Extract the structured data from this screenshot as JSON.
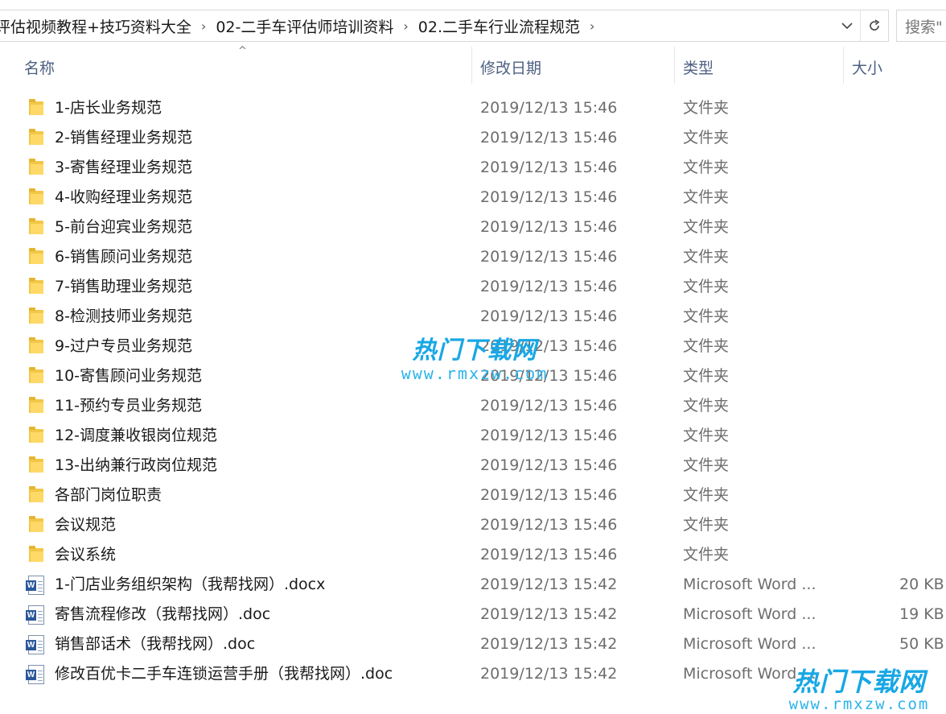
{
  "breadcrumb": [
    "评估视频教程+技巧资料大全",
    "02-二手车评估师培训资料",
    "02.二手车行业流程规范"
  ],
  "search": {
    "placeholder": "搜索\""
  },
  "columns": {
    "name": "名称",
    "date": "修改日期",
    "type": "类型",
    "size": "大小"
  },
  "files": [
    {
      "name": "1-店长业务规范",
      "date": "2019/12/13 15:46",
      "type": "文件夹",
      "size": "",
      "icon": "folder-icon"
    },
    {
      "name": "2-销售经理业务规范",
      "date": "2019/12/13 15:46",
      "type": "文件夹",
      "size": "",
      "icon": "folder-icon"
    },
    {
      "name": "3-寄售经理业务规范",
      "date": "2019/12/13 15:46",
      "type": "文件夹",
      "size": "",
      "icon": "folder-icon"
    },
    {
      "name": "4-收购经理业务规范",
      "date": "2019/12/13 15:46",
      "type": "文件夹",
      "size": "",
      "icon": "folder-icon"
    },
    {
      "name": "5-前台迎宾业务规范",
      "date": "2019/12/13 15:46",
      "type": "文件夹",
      "size": "",
      "icon": "folder-icon"
    },
    {
      "name": "6-销售顾问业务规范",
      "date": "2019/12/13 15:46",
      "type": "文件夹",
      "size": "",
      "icon": "folder-icon"
    },
    {
      "name": "7-销售助理业务规范",
      "date": "2019/12/13 15:46",
      "type": "文件夹",
      "size": "",
      "icon": "folder-icon"
    },
    {
      "name": "8-检测技师业务规范",
      "date": "2019/12/13 15:46",
      "type": "文件夹",
      "size": "",
      "icon": "folder-icon"
    },
    {
      "name": "9-过户专员业务规范",
      "date": "2019/12/13 15:46",
      "type": "文件夹",
      "size": "",
      "icon": "folder-icon"
    },
    {
      "name": "10-寄售顾问业务规范",
      "date": "2019/12/13 15:46",
      "type": "文件夹",
      "size": "",
      "icon": "folder-icon"
    },
    {
      "name": "11-预约专员业务规范",
      "date": "2019/12/13 15:46",
      "type": "文件夹",
      "size": "",
      "icon": "folder-icon"
    },
    {
      "name": "12-调度兼收银岗位规范",
      "date": "2019/12/13 15:46",
      "type": "文件夹",
      "size": "",
      "icon": "folder-icon"
    },
    {
      "name": "13-出纳兼行政岗位规范",
      "date": "2019/12/13 15:46",
      "type": "文件夹",
      "size": "",
      "icon": "folder-icon"
    },
    {
      "name": "各部门岗位职责",
      "date": "2019/12/13 15:46",
      "type": "文件夹",
      "size": "",
      "icon": "folder-icon"
    },
    {
      "name": "会议规范",
      "date": "2019/12/13 15:46",
      "type": "文件夹",
      "size": "",
      "icon": "folder-icon"
    },
    {
      "name": "会议系统",
      "date": "2019/12/13 15:46",
      "type": "文件夹",
      "size": "",
      "icon": "folder-icon"
    },
    {
      "name": "1-门店业务组织架构（我帮找网）.docx",
      "date": "2019/12/13 15:42",
      "type": "Microsoft Word ...",
      "size": "20 KB",
      "icon": "word-doc-icon"
    },
    {
      "name": "寄售流程修改（我帮找网）.doc",
      "date": "2019/12/13 15:42",
      "type": "Microsoft Word ...",
      "size": "19 KB",
      "icon": "word-doc-icon"
    },
    {
      "name": "销售部话术（我帮找网）.doc",
      "date": "2019/12/13 15:42",
      "type": "Microsoft Word ...",
      "size": "50 KB",
      "icon": "word-doc-icon"
    },
    {
      "name": "修改百优卡二手车连锁运营手册（我帮找网）.doc",
      "date": "2019/12/13 15:42",
      "type": "Microsoft Word ...",
      "size": "",
      "icon": "word-doc-icon"
    }
  ],
  "watermark": {
    "title": "热门下载网",
    "url": "www.rmxzw.com"
  },
  "colors": {
    "header_text": "#4d6082",
    "folder": "#f2c746",
    "word": "#2b579a",
    "watermark": "#18a7e5"
  }
}
